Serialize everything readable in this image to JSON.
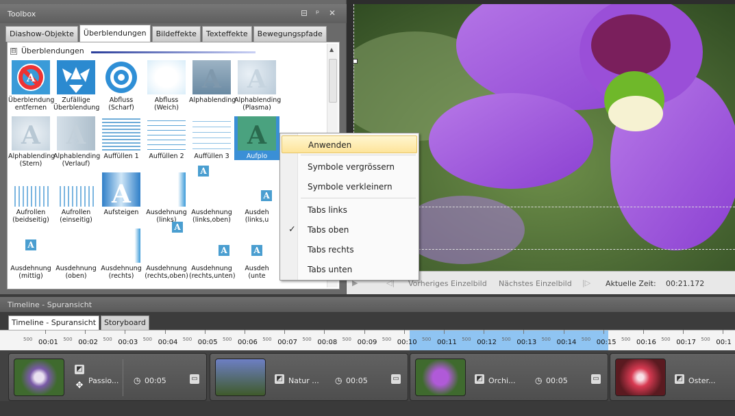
{
  "toolbox": {
    "title": "Toolbox",
    "btn_pin": "⊟",
    "btn_float": "ᵖ",
    "btn_close": "✕"
  },
  "tabs": [
    "Diashow-Objekte",
    "Überblendungen",
    "Bildeffekte",
    "Texteffekte",
    "Bewegungspfade"
  ],
  "group": {
    "toggle": "⊟",
    "label": "Überblendungen"
  },
  "items": [
    "Überblendung\nentfernen",
    "Zufällige\nÜberblendung",
    "Abfluss\n(Scharf)",
    "Abfluss\n(Weich)",
    "Alphablending",
    "Alphablending\n(Plasma)",
    "Alphablending\n(Stern)",
    "Alphablending\n(Verlauf)",
    "Auffüllen 1",
    "Auffüllen 2",
    "Auffüllen 3",
    "Aufplo",
    "Aufrollen\n(beidseitig)",
    "Aufrollen\n(einseitig)",
    "Aufsteigen",
    "Ausdehnung\n(links)",
    "Ausdehnung\n(links,oben)",
    "Ausdeh\n(links,u",
    "Ausdehnung\n(mittig)",
    "Ausdehnung\n(oben)",
    "Ausdehnung\n(rechts)",
    "Ausdehnung\n(rechts,oben)",
    "Ausdehnung\n(rechts,unten)",
    "Ausdeh\n(unte"
  ],
  "context_menu": {
    "apply": "Anwenden",
    "enlarge": "Symbole vergrössern",
    "shrink": "Symbole verkleinern",
    "tabs_left": "Tabs links",
    "tabs_top": "Tabs oben",
    "tabs_right": "Tabs rechts",
    "tabs_bottom": "Tabs unten",
    "check": "✓"
  },
  "preview_controls": {
    "prev": "Vorheriges Einzelbild",
    "next": "Nächstes Einzelbild",
    "time_label": "Aktuelle Zeit:",
    "time_value": "00:21.172"
  },
  "timeline": {
    "title": "Timeline - Spuransicht",
    "tabs": [
      "Timeline - Spuransicht",
      "Storyboard"
    ],
    "sub_tick": "500",
    "ticks": [
      "00:01",
      "00:02",
      "00:03",
      "00:04",
      "00:05",
      "00:06",
      "00:07",
      "00:08",
      "00:09",
      "00:10",
      "00:11",
      "00:12",
      "00:13",
      "00:14",
      "00:15",
      "00:16",
      "00:17",
      "00:1"
    ],
    "clips": [
      {
        "name": "Passio...",
        "duration": "00:05"
      },
      {
        "name": "Natur ...",
        "duration": "00:05"
      },
      {
        "name": "Orchi...",
        "duration": "00:05"
      },
      {
        "name": "Oster...",
        "duration": ""
      }
    ]
  }
}
